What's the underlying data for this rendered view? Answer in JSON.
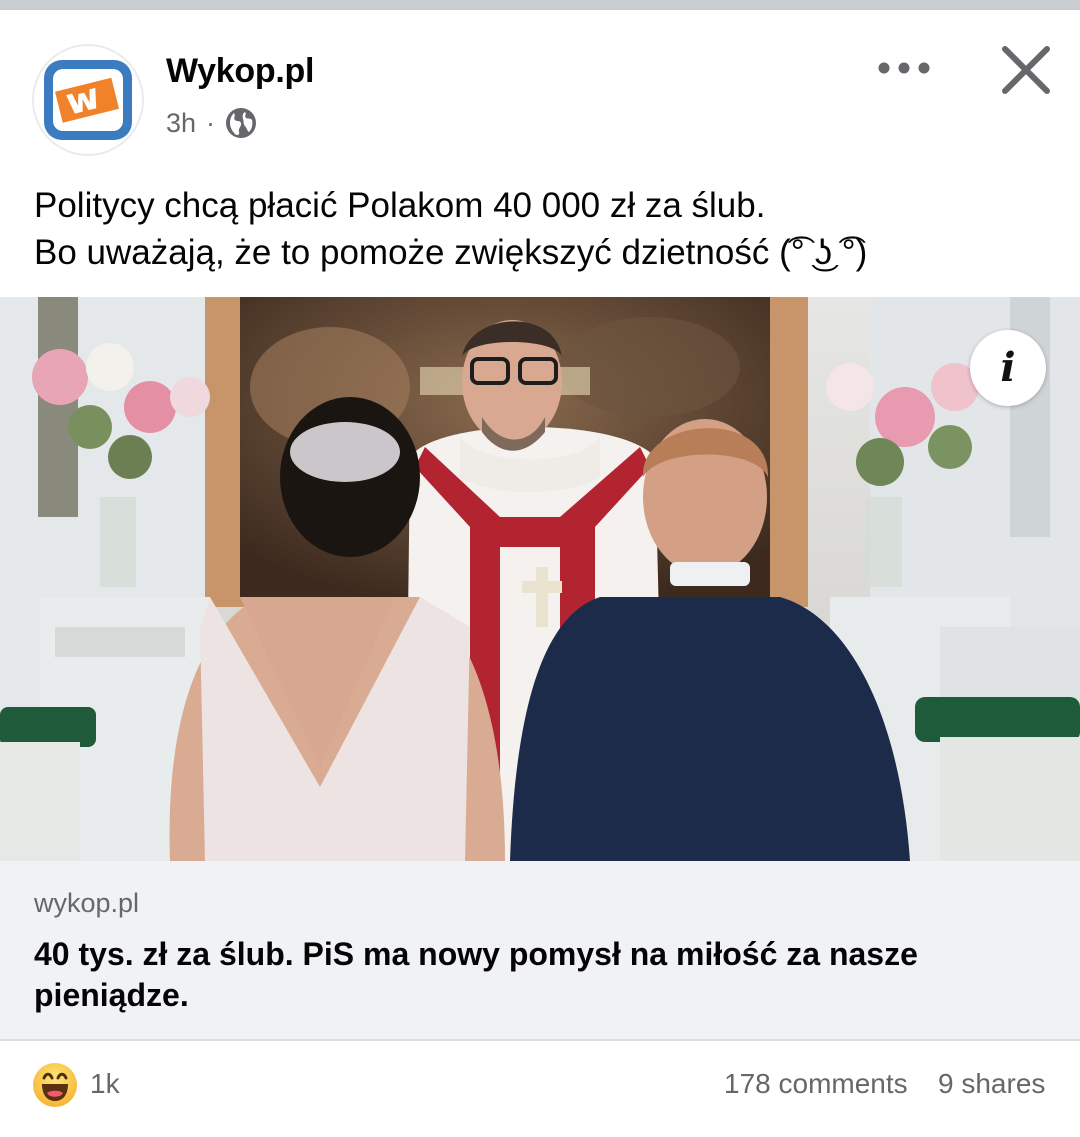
{
  "post": {
    "page_name": "Wykop.pl",
    "time": "3h",
    "separator": "·",
    "audience_icon": "globe-icon",
    "text_line1": "Politycy chcą płacić Polakom 40 000 zł za ślub.",
    "text_line2": "Bo uważają, że to pomoże zwiększyć dzietność (͡° ͜ʖ ͡°)"
  },
  "header_actions": {
    "more_icon": "more-horizontal-icon",
    "close_icon": "close-icon"
  },
  "image": {
    "info_label": "i"
  },
  "link_preview": {
    "domain": "wykop.pl",
    "title": "40 tys. zł za ślub. PiS ma nowy pomysł na miłość za nasze pieniądze."
  },
  "footer": {
    "reaction_icon": "haha-reaction-icon",
    "reactions_count": "1k",
    "comments": "178 comments",
    "shares": "9 shares"
  },
  "colors": {
    "logo_blue": "#3b7bbf",
    "logo_orange": "#f0822a",
    "secondary_text": "#65676b",
    "link_bg": "#f0f2f5"
  }
}
